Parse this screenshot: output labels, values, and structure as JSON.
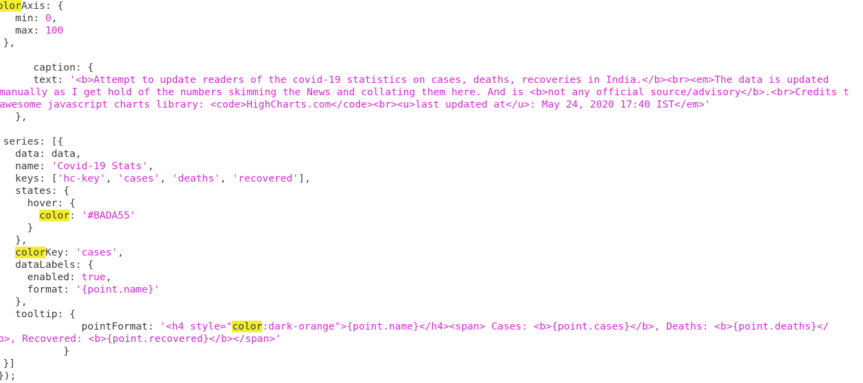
{
  "editor": {
    "colors": {
      "text": "#3b3b3b",
      "string": "#d42ad4",
      "search_highlight": "#f2ee2a",
      "background": "#ffffff"
    },
    "search_term": "color",
    "lines": [
      {
        "segments": [
          {
            "t": ""
          },
          {
            "t": "color",
            "c": "hl"
          },
          {
            "t": "Axis: {"
          }
        ]
      },
      {
        "segments": [
          {
            "t": "    min: "
          },
          {
            "t": "0",
            "c": "num"
          },
          {
            "t": ","
          }
        ]
      },
      {
        "segments": [
          {
            "t": "    max: "
          },
          {
            "t": "100",
            "c": "num"
          }
        ]
      },
      {
        "segments": [
          {
            "t": "  },"
          }
        ]
      },
      {
        "segments": [
          {
            "t": ""
          }
        ]
      },
      {
        "segments": [
          {
            "t": "       caption: {"
          }
        ]
      },
      {
        "segments": [
          {
            "t": "       text: "
          },
          {
            "t": "'<b>Attempt to update readers of the covid-19 statistics on cases, deaths, recoveries in India.</b><br><em>The data is updated",
            "c": "str"
          }
        ]
      },
      {
        "segments": [
          {
            "t": "manually as I get hold of the numbers skimming the News and collating them here. And is <b>not any official source/advisory</b>.<br>Credits t",
            "c": "str"
          }
        ]
      },
      {
        "segments": [
          {
            "t": "awesome javascript charts library: <code>HighCharts.com</code><br><u>last updated at</u>: May 24, 2020 17:40 IST</em>'",
            "c": "str"
          }
        ]
      },
      {
        "segments": [
          {
            "t": "    },"
          }
        ]
      },
      {
        "segments": [
          {
            "t": ""
          }
        ]
      },
      {
        "segments": [
          {
            "t": "  series: [{"
          }
        ]
      },
      {
        "segments": [
          {
            "t": "    data: data,"
          }
        ]
      },
      {
        "segments": [
          {
            "t": "    name: "
          },
          {
            "t": "'Covid-19 Stats'",
            "c": "str"
          },
          {
            "t": ","
          }
        ]
      },
      {
        "segments": [
          {
            "t": "    keys: ["
          },
          {
            "t": "'hc-key'",
            "c": "str"
          },
          {
            "t": ", "
          },
          {
            "t": "'cases'",
            "c": "str"
          },
          {
            "t": ", "
          },
          {
            "t": "'deaths'",
            "c": "str"
          },
          {
            "t": ", "
          },
          {
            "t": "'recovered'",
            "c": "str"
          },
          {
            "t": "],"
          }
        ]
      },
      {
        "segments": [
          {
            "t": "    states: {"
          }
        ]
      },
      {
        "segments": [
          {
            "t": "      hover: {"
          }
        ]
      },
      {
        "segments": [
          {
            "t": "        "
          },
          {
            "t": "color",
            "c": "hl"
          },
          {
            "t": ": "
          },
          {
            "t": "'#BADA55'",
            "c": "str"
          }
        ]
      },
      {
        "segments": [
          {
            "t": "      }"
          }
        ]
      },
      {
        "segments": [
          {
            "t": "    },"
          }
        ]
      },
      {
        "segments": [
          {
            "t": "    "
          },
          {
            "t": "color",
            "c": "hl"
          },
          {
            "t": "Key: "
          },
          {
            "t": "'cases'",
            "c": "str"
          },
          {
            "t": ","
          }
        ]
      },
      {
        "segments": [
          {
            "t": "    dataLabels: {"
          }
        ]
      },
      {
        "segments": [
          {
            "t": "      enabled: "
          },
          {
            "t": "true",
            "c": "kw"
          },
          {
            "t": ","
          }
        ]
      },
      {
        "segments": [
          {
            "t": "      format: "
          },
          {
            "t": "'{point.name}'",
            "c": "str"
          }
        ]
      },
      {
        "segments": [
          {
            "t": "    },"
          }
        ]
      },
      {
        "segments": [
          {
            "t": "    tooltip: {"
          }
        ]
      },
      {
        "segments": [
          {
            "t": "               pointFormat: "
          },
          {
            "t": "'<h4 style=\"",
            "c": "str"
          },
          {
            "t": "color",
            "c": "hl"
          },
          {
            "t": ":dark-orange\">{point.name}</h4><span> Cases: <b>{point.cases}</b>, Deaths: <b>{point.deaths}</",
            "c": "str"
          }
        ]
      },
      {
        "segments": [
          {
            "t": "b>, Recovered: <b>{point.recovered}</b></span>'",
            "c": "str"
          }
        ]
      },
      {
        "segments": [
          {
            "t": "            }"
          }
        ]
      },
      {
        "segments": [
          {
            "t": "  }]"
          }
        ]
      },
      {
        "segments": [
          {
            "t": "});"
          }
        ]
      }
    ]
  }
}
